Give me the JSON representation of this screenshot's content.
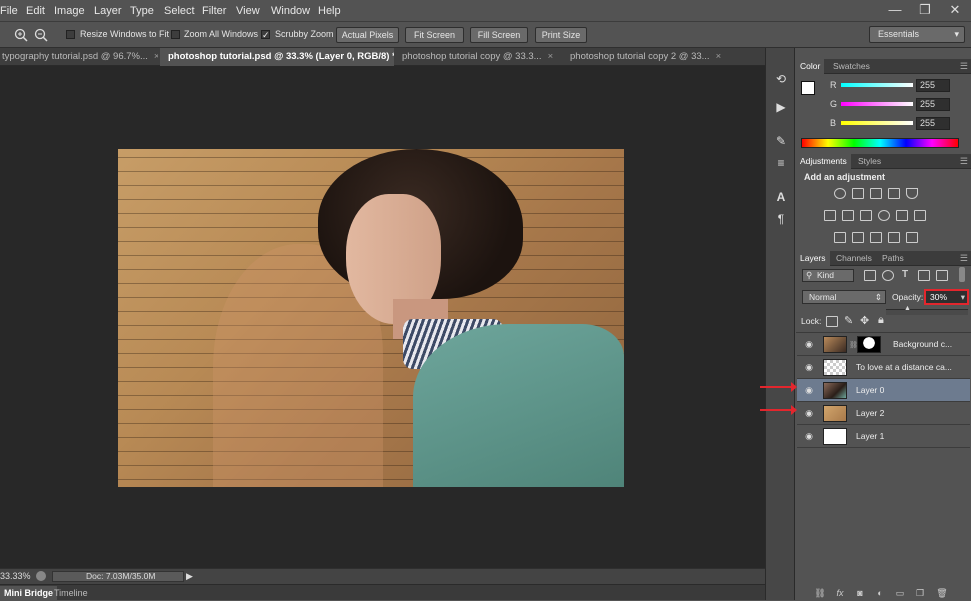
{
  "menu": [
    "File",
    "Edit",
    "Image",
    "Layer",
    "Type",
    "Select",
    "Filter",
    "View",
    "Window",
    "Help"
  ],
  "window_controls": {
    "minimize": "—",
    "restore": "❐",
    "close": "✕"
  },
  "options": {
    "resize_windows": "Resize Windows to Fit",
    "zoom_all": "Zoom All Windows",
    "scrubby_zoom": "Scrubby Zoom",
    "actual_pixels": "Actual Pixels",
    "fit_screen": "Fit Screen",
    "fill_screen": "Fill Screen",
    "print_size": "Print Size",
    "workspace": "Essentials"
  },
  "tabs": [
    {
      "label": "typography tutorial.psd @ 96.7%...",
      "active": false
    },
    {
      "label": "photoshop tutorial.psd @ 33.3% (Layer 0, RGB/8) *",
      "active": true
    },
    {
      "label": "photoshop tutorial copy @ 33.3...",
      "active": false
    },
    {
      "label": "photoshop tutorial copy 2 @ 33...",
      "active": false
    }
  ],
  "tab_close": "×",
  "status": {
    "zoom": "33.33%",
    "doc": "Doc: 7.03M/35.0M"
  },
  "bottom_tabs": [
    "Mini Bridge",
    "Timeline"
  ],
  "color_panel": {
    "tabs": [
      "Color",
      "Swatches"
    ],
    "channels": [
      {
        "label": "R",
        "value": "255"
      },
      {
        "label": "G",
        "value": "255"
      },
      {
        "label": "B",
        "value": "255"
      }
    ]
  },
  "adjustments_panel": {
    "tabs": [
      "Adjustments",
      "Styles"
    ],
    "title": "Add an adjustment"
  },
  "layers_panel": {
    "tabs": [
      "Layers",
      "Channels",
      "Paths"
    ],
    "filter_kind": "Kind",
    "blend_mode": "Normal",
    "opacity_label": "Opacity:",
    "opacity_value": "30%",
    "lock_label": "Lock:",
    "layers": [
      {
        "name": "Background c...",
        "selected": false
      },
      {
        "name": "To love at a distance ca...",
        "selected": false
      },
      {
        "name": "Layer 0",
        "selected": true
      },
      {
        "name": "Layer 2",
        "selected": false
      },
      {
        "name": "Layer 1",
        "selected": false
      }
    ]
  },
  "colors": {
    "accent_red": "#e3262d",
    "selected_layer": "#6d7b8f"
  }
}
